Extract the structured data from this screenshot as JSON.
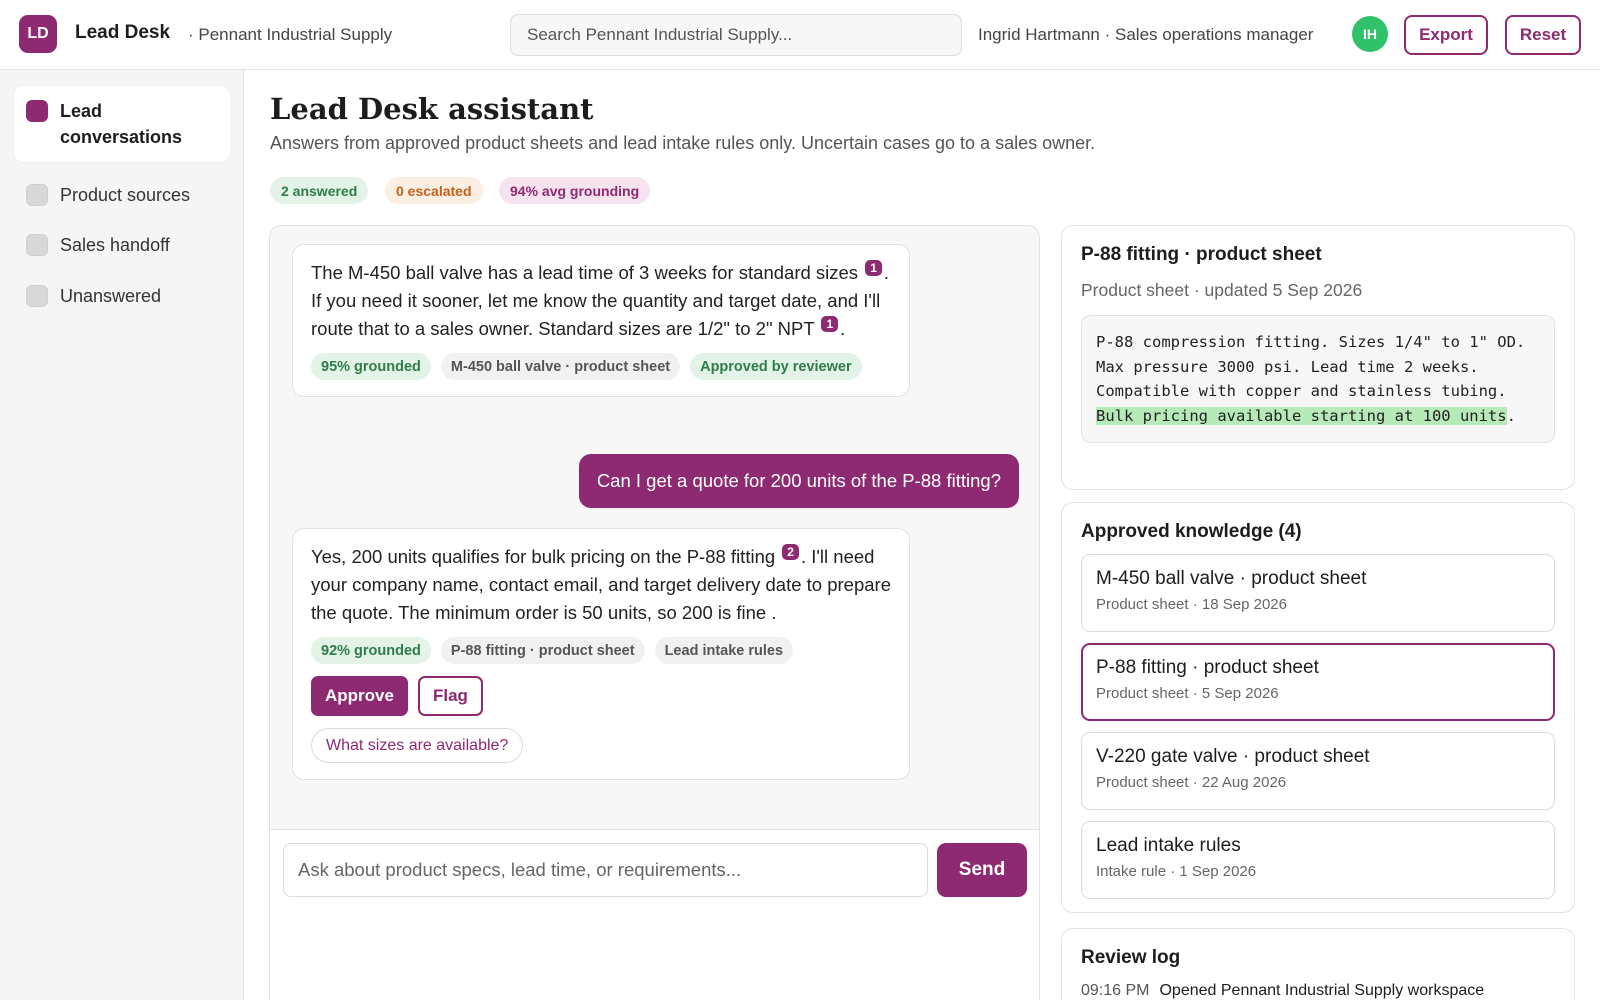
{
  "header": {
    "logo_initials": "LD",
    "app_name": "Lead Desk",
    "org_name": "· Pennant Industrial Supply",
    "search_placeholder": "Search Pennant Industrial Supply...",
    "user_label": "Ingrid Hartmann · Sales operations manager",
    "avatar_initials": "IH",
    "export_label": "Export",
    "reset_label": "Reset"
  },
  "sidebar": {
    "items": [
      {
        "label": "Lead conversations",
        "active": true
      },
      {
        "label": "Product sources",
        "active": false
      },
      {
        "label": "Sales handoff",
        "active": false
      },
      {
        "label": "Unanswered",
        "active": false
      }
    ]
  },
  "main": {
    "title": "Lead Desk assistant",
    "subtitle": "Answers from approved product sheets and lead intake rules only. Uncertain cases go to a sales owner.",
    "stats": {
      "answered": "2 answered",
      "escalated": "0 escalated",
      "grounding": "94% avg grounding"
    }
  },
  "chat": {
    "messages": [
      {
        "role": "assistant",
        "parts": [
          "The M-450 ball valve has a lead time of 3 weeks for standard sizes ",
          ". If you need it sooner, let me know the quantity and target date, and I'll route that to a sales owner. Standard sizes are 1/2\" to 2\" NPT ",
          "."
        ],
        "citations": [
          "1",
          "1"
        ],
        "grounded": "95% grounded",
        "source": "M-450 ball valve · product sheet",
        "status": "Approved by reviewer"
      },
      {
        "role": "user",
        "text": "Can I get a quote for 200 units of the P-88 fitting?"
      },
      {
        "role": "assistant",
        "parts": [
          "Yes, 200 units qualifies for bulk pricing on the P-88 fitting ",
          ". I'll need your company name, contact email, and target delivery date to prepare the quote. The minimum order is 50 units, so 200 is fine ."
        ],
        "citations": [
          "2"
        ],
        "grounded": "92% grounded",
        "sources": [
          "P-88 fitting · product sheet",
          "Lead intake rules"
        ],
        "approve_label": "Approve",
        "flag_label": "Flag",
        "suggestion": "What sizes are available?"
      }
    ],
    "composer_placeholder": "Ask about product specs, lead time, or requirements...",
    "send_label": "Send"
  },
  "source_panel": {
    "title": "P-88 fitting · product sheet",
    "meta": "Product sheet · updated 5 Sep 2026",
    "text_before": "P-88 compression fitting. Sizes 1/4\" to 1\" OD. Max pressure 3000 psi. Lead time 2 weeks. Compatible with copper and stainless tubing. ",
    "text_highlight": "Bulk pricing available starting at 100 units",
    "text_after": "."
  },
  "knowledge": {
    "title": "Approved knowledge (4)",
    "items": [
      {
        "title": "M-450 ball valve · product sheet",
        "meta": "Product sheet · 18 Sep 2026",
        "selected": false
      },
      {
        "title": "P-88 fitting · product sheet",
        "meta": "Product sheet · 5 Sep 2026",
        "selected": true
      },
      {
        "title": "V-220 gate valve · product sheet",
        "meta": "Product sheet · 22 Aug 2026",
        "selected": false
      },
      {
        "title": "Lead intake rules",
        "meta": "Intake rule · 1 Sep 2026",
        "selected": false
      }
    ]
  },
  "review_log": {
    "title": "Review log",
    "entries": [
      {
        "time": "09:16 PM",
        "text": "Opened Pennant Industrial Supply workspace"
      }
    ]
  },
  "colors": {
    "accent": "#8e2a72",
    "avatar": "#32c16b",
    "grounded_bg": "#e3f3e8",
    "grounded_text": "#2f7d4a",
    "escalated_text": "#c4621b",
    "highlight": "#b6ebb9"
  }
}
